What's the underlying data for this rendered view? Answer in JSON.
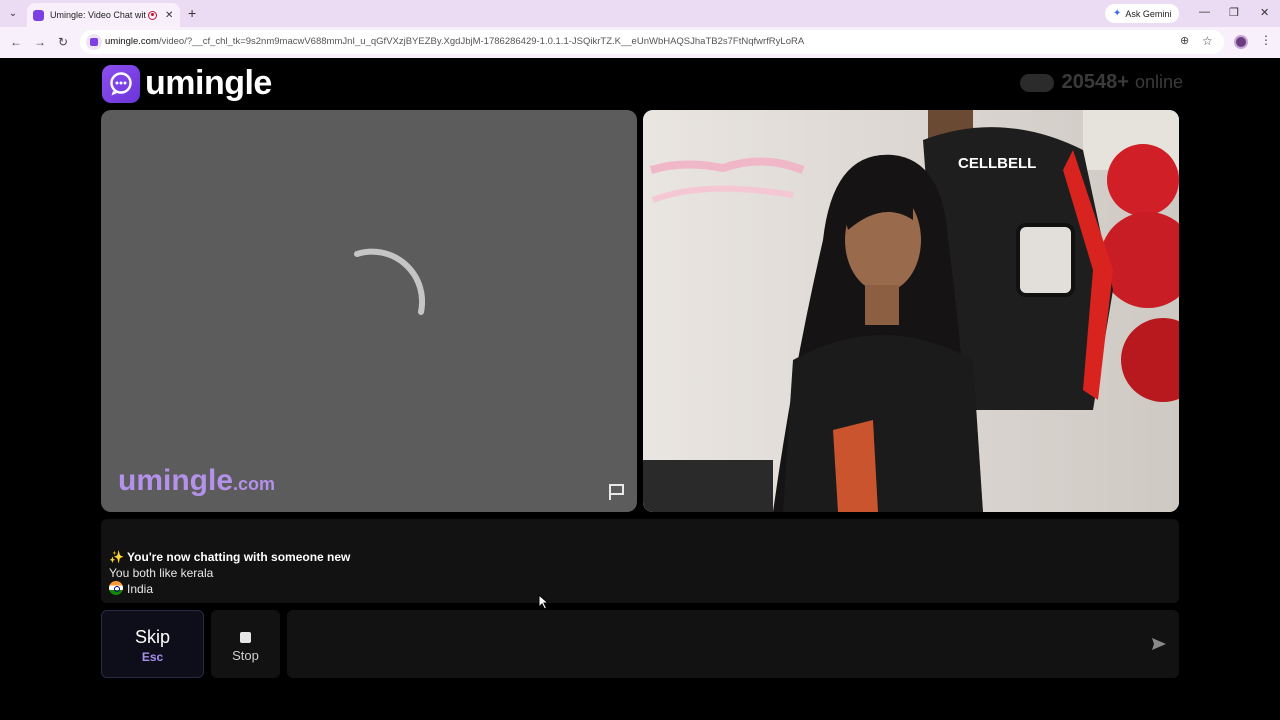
{
  "browser": {
    "tab_title": "Umingle: Video Chat with Stranger",
    "tab_close": "✕",
    "new_tab": "+",
    "ask_gemini": "Ask Gemini",
    "url_host": "umingle.com",
    "url_path": "/video/?__cf_chl_tk=9s2nm9macwV688mmJnI_u_qGfVXzjBYEZBy.XgdJbjM-1786286429-1.0.1.1-JSQikrTZ.K__eUnWbHAQSJhaTB2s7FtNqfwrfRyLoRA",
    "accent": "#7b3fe4"
  },
  "header": {
    "logo_text": "umingle",
    "online_count": "20548+",
    "online_label": "online"
  },
  "stranger_video": {
    "watermark_name": "umingle",
    "watermark_suffix": ".com"
  },
  "chat": {
    "new_chat_message": "✨ You're now chatting with someone new",
    "interest_message": "You both like kerala",
    "country": "India"
  },
  "controls": {
    "skip_label": "Skip",
    "skip_key": "Esc",
    "stop_label": "Stop",
    "message_placeholder": ""
  }
}
